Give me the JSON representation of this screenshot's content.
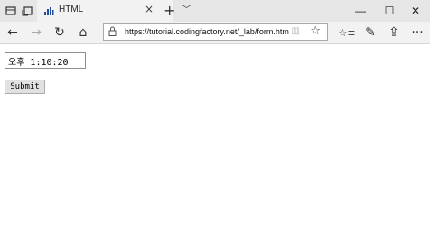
{
  "browser": {
    "tab": {
      "title": "HTML",
      "close": "×"
    },
    "tab_controls": {
      "new_tab": "+",
      "tab_menu": "﹀"
    },
    "window": {
      "minimize": "—",
      "maximize": "☐",
      "close": "✕"
    },
    "nav": {
      "back": "←",
      "forward": "→",
      "refresh": "↻",
      "home": "⌂"
    },
    "address": {
      "url": "https://tutorial.codingfactory.net/_lab/form.htm",
      "reading_icon": "▥",
      "favorite_icon": "☆"
    },
    "toolbar": {
      "favorites_icon": "☆≡",
      "notes_icon": "✎",
      "share_icon": "⇪",
      "more_icon": "···"
    }
  },
  "form": {
    "time_value": "오후 1:10:20",
    "submit_label": "Submit"
  }
}
